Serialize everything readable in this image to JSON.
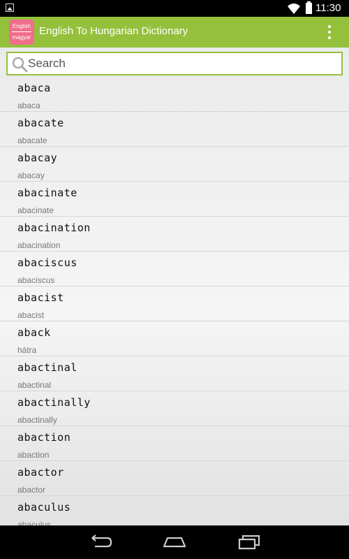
{
  "status_bar": {
    "time": "11:30"
  },
  "app": {
    "logo_line1": "English",
    "logo_line2": "magyar",
    "title": "English To Hungarian Dictionary",
    "accent_color": "#94c03c",
    "logo_color": "#f06e8a"
  },
  "search": {
    "placeholder": "Search",
    "value": ""
  },
  "words": [
    {
      "term": "abaca",
      "translation": "abaca"
    },
    {
      "term": "abacate",
      "translation": "abacate"
    },
    {
      "term": "abacay",
      "translation": "abacay"
    },
    {
      "term": "abacinate",
      "translation": "abacinate"
    },
    {
      "term": "abacination",
      "translation": "abacination"
    },
    {
      "term": "abaciscus",
      "translation": "abaciscus"
    },
    {
      "term": "abacist",
      "translation": "abacist"
    },
    {
      "term": "aback",
      "translation": "hátra"
    },
    {
      "term": "abactinal",
      "translation": "abactinal"
    },
    {
      "term": "abactinally",
      "translation": "abactinally"
    },
    {
      "term": "abaction",
      "translation": "abaction"
    },
    {
      "term": "abactor",
      "translation": "abactor"
    },
    {
      "term": "abaculus",
      "translation": "abaculus"
    }
  ],
  "icons": {
    "notification": "image-notification-icon",
    "wifi": "wifi-icon",
    "battery": "battery-icon",
    "menu": "overflow-menu-icon",
    "search": "search-icon",
    "back": "back-icon",
    "home": "home-icon",
    "recents": "recent-apps-icon"
  }
}
